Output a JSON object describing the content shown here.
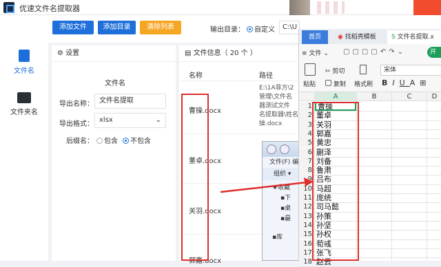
{
  "app": {
    "title": "优速文件名提取器"
  },
  "sidebar": {
    "items": [
      {
        "label": "文件名",
        "color": "#1e6fd9"
      },
      {
        "label": "文件夹名",
        "color": "#333333"
      }
    ]
  },
  "toolbar": {
    "add_file": "添加文件",
    "add_dir": "添加目录",
    "clear_list": "清除列表",
    "output_label": "输出目录：",
    "output_mode": "自定义",
    "output_path": "C:\\U"
  },
  "settings": {
    "title": "设置",
    "section": "文件名",
    "export_name_label": "导出名称：",
    "export_name_value": "文件名提取",
    "export_format_label": "导出格式：",
    "export_format_value": "xlsx",
    "suffix_label": "后缀名：",
    "suffix_include": "包含",
    "suffix_exclude": "不包含"
  },
  "files": {
    "header": "文件信息（ 20 个 ）",
    "col_name": "名称",
    "col_path": "路径",
    "rows": [
      {
        "name": "曹操.docx",
        "path_lines": [
          "E:\\1A菲方\\2",
          "管理\\文件名",
          "器测试文件",
          "名提取器\\姓名",
          "操.docx"
        ]
      },
      {
        "name": "董卓.docx",
        "path_lines": []
      },
      {
        "name": "关羽.docx",
        "path_lines": []
      },
      {
        "name": "郭嘉.docx",
        "path_lines": []
      }
    ]
  },
  "explorer": {
    "menu_file": "文件(F)",
    "menu_edit": "编",
    "organize": "组织 ▾",
    "items": [
      "收藏",
      "下",
      "桌",
      "最",
      "库"
    ]
  },
  "wps": {
    "tabs": [
      "首页",
      "找稻壳模板",
      "文件名提取.x"
    ],
    "menu_file": "文件",
    "open_btn": "开始",
    "paste": "粘贴",
    "cut": "剪切",
    "copy": "复制",
    "format_painter": "格式刷",
    "font": "宋体",
    "columns": [
      "A",
      "B",
      "C",
      "D"
    ],
    "names": [
      "曹操",
      "董卓",
      "关羽",
      "郭嘉",
      "黄忠",
      "蒯泽",
      "刘备",
      "鲁肃",
      "吕布",
      "马超",
      "庞统",
      "司马懿",
      "孙策",
      "孙坚",
      "孙权",
      "荀彧",
      "张飞",
      "赵云"
    ]
  },
  "colors": {
    "accent": "#1e6fd9",
    "orange": "#f5a623",
    "annotation_red": "#e02e2e",
    "excel_green": "#1d9f5a"
  }
}
